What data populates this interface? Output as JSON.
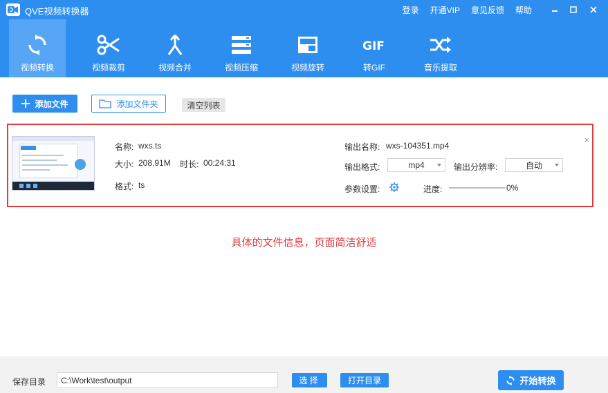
{
  "app": {
    "title": "QVE视频转换器",
    "top_links": [
      "登录",
      "开通VIP",
      "意见反馈",
      "帮助"
    ],
    "accent_color": "#2d8ef0"
  },
  "tabs": [
    {
      "label": "视频转换",
      "icon": "convert-icon",
      "active": true
    },
    {
      "label": "视频裁剪",
      "icon": "scissors-icon",
      "active": false
    },
    {
      "label": "视频合并",
      "icon": "merge-icon",
      "active": false
    },
    {
      "label": "视频压缩",
      "icon": "compress-icon",
      "active": false
    },
    {
      "label": "视频旋转",
      "icon": "rotate-icon",
      "active": false
    },
    {
      "label": "转GIF",
      "icon": "gif-icon",
      "active": false
    },
    {
      "label": "音乐提取",
      "icon": "shuffle-icon",
      "active": false
    }
  ],
  "toolbar": {
    "add_file_label": "添加文件",
    "add_folder_label": "添加文件夹",
    "clear_label": "清空列表"
  },
  "file": {
    "name_label": "名称:",
    "name": "wxs.ts",
    "size_label": "大小:",
    "size": "208.91M",
    "duration_label": "时长:",
    "duration": "00:24:31",
    "format_label": "格式:",
    "format": "ts",
    "output_name_label": "输出名称:",
    "output_name": "wxs-104351.mp4",
    "output_format_label": "输出格式:",
    "output_format": "mp4",
    "output_resolution_label": "输出分辨率:",
    "output_resolution": "自动",
    "params_label": "参数设置:",
    "progress_label": "进度:",
    "progress": 0,
    "progress_text": "0%",
    "close": "×"
  },
  "annotation": "具体的文件信息，页面简洁舒适",
  "footer": {
    "save_dir_label": "保存目录",
    "save_path": "C:\\Work\\test\\output",
    "choose_label": "选择",
    "open_dir_label": "打开目录",
    "start_label": "开始转换"
  }
}
